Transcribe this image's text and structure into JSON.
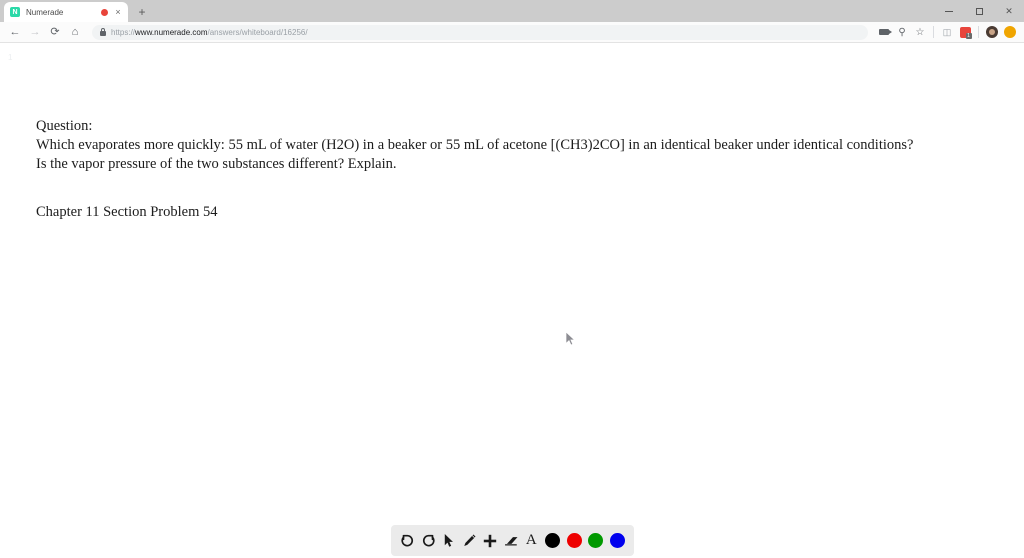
{
  "window": {
    "controls": {
      "minimize": "minimize-button",
      "maximize": "maximize-button",
      "close": "close-button"
    }
  },
  "tab": {
    "title": "Numerade",
    "favicon_letter": "N",
    "favicon_color": "#2bd9a8",
    "recording_indicator_color": "#e8443a",
    "close_label": "×",
    "new_tab_label": "+"
  },
  "navigation": {
    "back_label": "←",
    "forward_label": "→",
    "reload_label": "⟳",
    "home_label": "⌂"
  },
  "omnibox": {
    "url_full": "https://www.numerade.com/answers/whiteboard/16256/",
    "url_prefix": "https://",
    "url_host": "www.numerade.com",
    "url_path": "/answers/whiteboard/16256/"
  },
  "browser_icons": [
    {
      "name": "screen-capture-icon",
      "label": ""
    },
    {
      "name": "search-icon",
      "label": "⌕"
    },
    {
      "name": "bookmark-star-icon",
      "label": "☆"
    },
    {
      "name": "extension-grey-icon",
      "label": "◧"
    },
    {
      "name": "extension-red-icon",
      "badge": "1"
    },
    {
      "name": "profile-avatar",
      "label": ""
    },
    {
      "name": "browser-menu-orb",
      "label": ""
    }
  ],
  "page": {
    "page_marker": "1",
    "question_heading": "Question:",
    "question_line_1": "Which evaporates more quickly: 55 mL of water (H2O) in a beaker or 55 mL of acetone [(CH3)2CO] in an identical beaker under identical conditions?",
    "question_line_2": "Is the vapor pressure of the two substances different? Explain.",
    "chapter_line": "Chapter 11 Section Problem 54"
  },
  "whiteboard_toolbar": {
    "tools": [
      {
        "name": "undo-button",
        "label": "Undo"
      },
      {
        "name": "redo-button",
        "label": "Redo"
      },
      {
        "name": "select-cursor-button",
        "label": "Select"
      },
      {
        "name": "pencil-button",
        "label": "Pencil"
      },
      {
        "name": "add-page-button",
        "label": "Add"
      },
      {
        "name": "eraser-button",
        "label": "Eraser"
      },
      {
        "name": "text-tool-button",
        "label": "A"
      }
    ],
    "colors": [
      {
        "name": "color-swatch-black",
        "value": "#000000"
      },
      {
        "name": "color-swatch-red",
        "value": "#ee0000"
      },
      {
        "name": "color-swatch-green",
        "value": "#009900"
      },
      {
        "name": "color-swatch-blue",
        "value": "#0000ee"
      }
    ],
    "background": "#ebebeb"
  }
}
